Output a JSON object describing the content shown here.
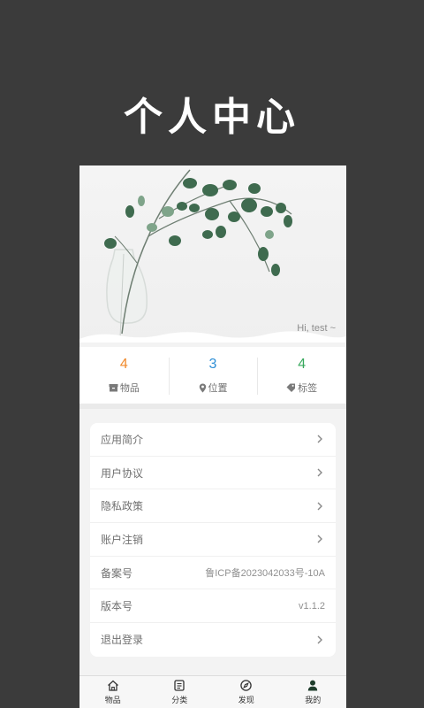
{
  "page": {
    "title": "个人中心"
  },
  "profile": {
    "greeting": "Hi, test ~"
  },
  "stats": [
    {
      "value": "4",
      "label": "物品",
      "icon": "box-icon",
      "color": "#f08a2c"
    },
    {
      "value": "3",
      "label": "位置",
      "icon": "location-pin-icon",
      "color": "#2f8fd6"
    },
    {
      "value": "4",
      "label": "标签",
      "icon": "tag-icon",
      "color": "#37a85c"
    }
  ],
  "menu": {
    "items": [
      {
        "label": "应用简介"
      },
      {
        "label": "用户协议"
      },
      {
        "label": "隐私政策"
      },
      {
        "label": "账户注销"
      },
      {
        "label": "备案号",
        "value": "鲁ICP备2023042033号-10A"
      },
      {
        "label": "版本号",
        "value": "v1.1.2"
      },
      {
        "label": "退出登录"
      }
    ]
  },
  "tabbar": {
    "active_color": "#1f3d2c",
    "items": [
      {
        "label": "物品",
        "icon": "home-icon"
      },
      {
        "label": "分类",
        "icon": "list-icon"
      },
      {
        "label": "发现",
        "icon": "compass-icon"
      },
      {
        "label": "我的",
        "icon": "person-icon",
        "active": true
      }
    ]
  }
}
